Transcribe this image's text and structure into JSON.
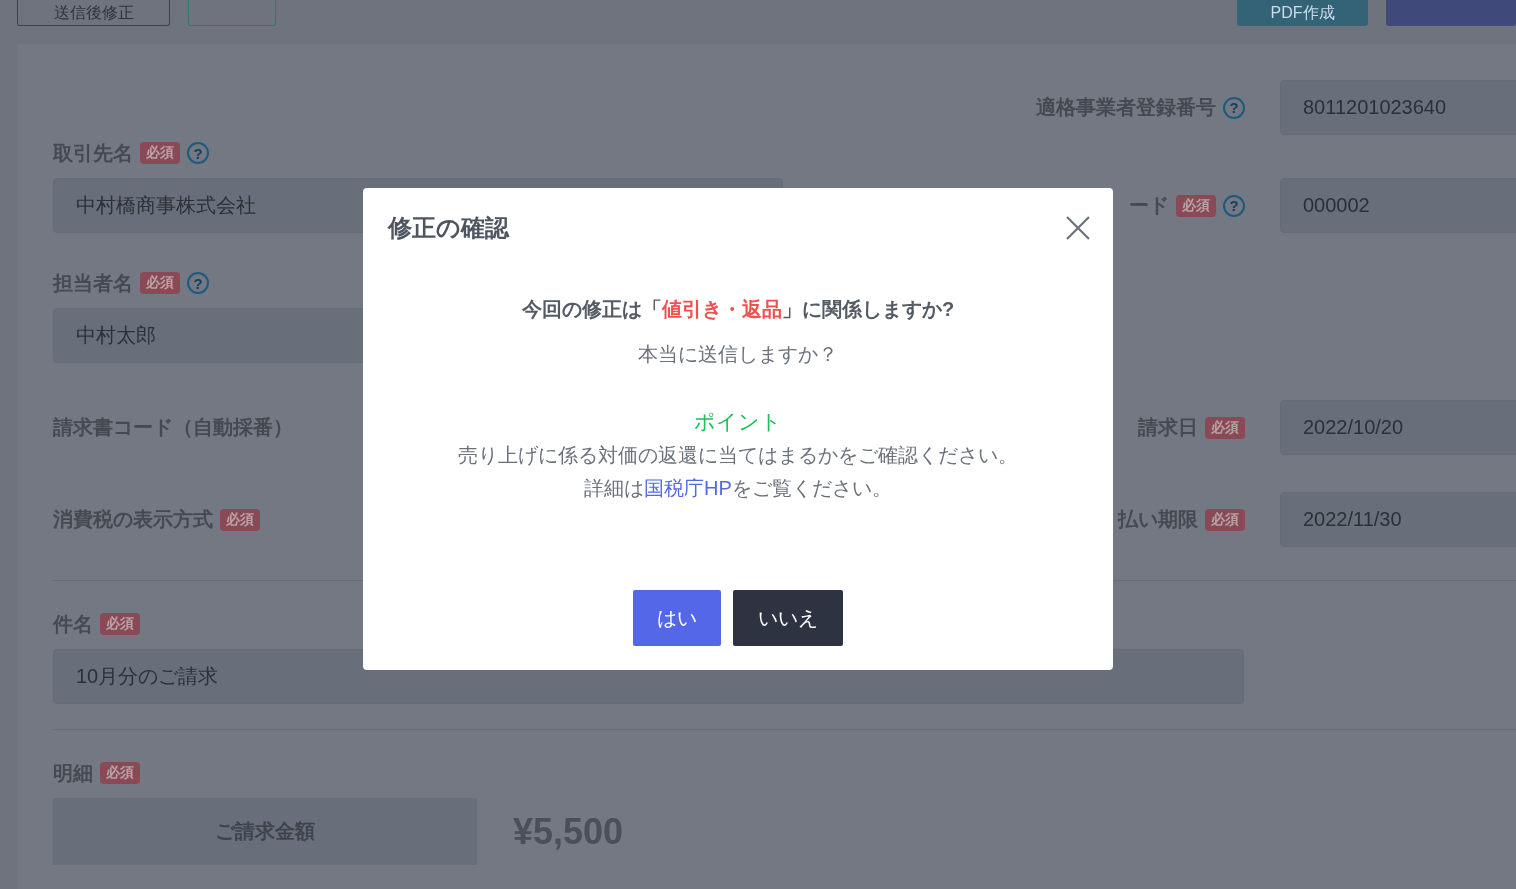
{
  "top_buttons": [
    {
      "label": "送信後修正",
      "kind": "outline"
    },
    {
      "kind": "outline-green"
    },
    {
      "label": "PDF作成",
      "kind": "teal"
    },
    {
      "kind": "blue"
    }
  ],
  "rows": [
    {
      "right": {
        "label": "適格事業者登録番号",
        "help": "?",
        "value": "8011201023640"
      }
    },
    {
      "left": {
        "label": "取引先名",
        "badge": "必須",
        "help": "?",
        "value": "中村橋商事株式会社"
      },
      "right": {
        "label": "ード",
        "badge": "必須",
        "help": "?",
        "value": "000002"
      }
    },
    {
      "left": {
        "label": "担当者名",
        "badge": "必須",
        "help": "?",
        "value": "中村太郎"
      }
    },
    {
      "left": {
        "label": "請求書コード（自動採番）"
      },
      "right": {
        "label": "請求日",
        "badge": "必須",
        "value": "2022/10/20"
      }
    },
    {
      "left": {
        "label": "消費税の表示方式",
        "badge": "必須"
      },
      "right": {
        "label": "払い期限",
        "badge": "必須",
        "value": "2022/11/30"
      }
    }
  ],
  "subject": {
    "label": "件名",
    "badge": "必須",
    "value": "10月分のご請求"
  },
  "details": {
    "label": "明細",
    "badge": "必須",
    "amount_label": "ご請求金額",
    "amount": "¥5,500"
  },
  "dialog": {
    "title": "修正の確認",
    "question": [
      {
        "text": "今回の修正は「",
        "emphasis": false
      },
      {
        "text": "値引き・返品",
        "emphasis": true
      },
      {
        "text": "」に関係しますか?",
        "emphasis": false
      }
    ],
    "confirm": "本当に送信しますか？",
    "point_title": "ポイント",
    "point_text": "売り上げに係る対価の返還に当てはまるかをご確認ください。",
    "detail": {
      "before": "詳細は",
      "link": "国税庁HP",
      "after": "をご覧ください。"
    },
    "buttons": [
      {
        "label": "はい",
        "kind": "primary"
      },
      {
        "label": "いいえ",
        "kind": "dark"
      }
    ]
  }
}
